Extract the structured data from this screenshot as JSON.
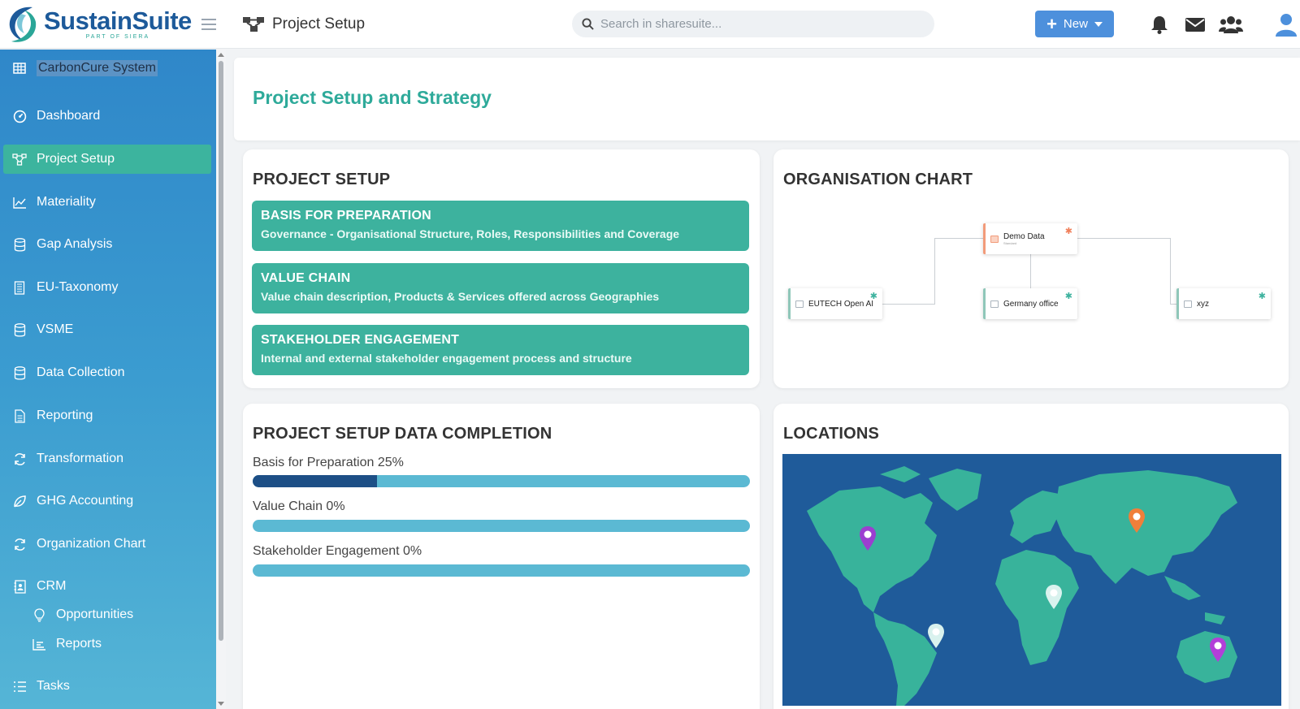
{
  "app": {
    "brand_name": "SustainSuite",
    "brand_sub": "PART OF SIERA"
  },
  "header": {
    "page_title": "Project Setup",
    "search_placeholder": "Search in sharesuite...",
    "new_button_label": "New"
  },
  "sidebar": {
    "company": "CarbonCure System",
    "items": [
      {
        "label": "Dashboard",
        "icon": "dashboard-icon"
      },
      {
        "label": "Project Setup",
        "icon": "project-setup-icon",
        "active": true
      },
      {
        "label": "Materiality",
        "icon": "line-chart-icon"
      },
      {
        "label": "Gap Analysis",
        "icon": "database-icon"
      },
      {
        "label": "EU-Taxonomy",
        "icon": "building-icon"
      },
      {
        "label": "VSME",
        "icon": "database-icon"
      },
      {
        "label": "Data Collection",
        "icon": "database-icon"
      },
      {
        "label": "Reporting",
        "icon": "document-icon"
      },
      {
        "label": "Transformation",
        "icon": "sync-icon"
      },
      {
        "label": "GHG Accounting",
        "icon": "leaf-icon"
      },
      {
        "label": "Organization Chart",
        "icon": "sync-icon"
      },
      {
        "label": "CRM",
        "icon": "contact-book-icon"
      }
    ],
    "crm_sub": [
      {
        "label": "Opportunities",
        "icon": "lightbulb-icon"
      },
      {
        "label": "Reports",
        "icon": "bar-chart-icon"
      }
    ],
    "tasks": {
      "label": "Tasks",
      "icon": "tasks-icon"
    }
  },
  "main": {
    "title": "Project Setup and Strategy",
    "project_setup": {
      "heading": "PROJECT SETUP",
      "tiles": [
        {
          "title": "BASIS FOR PREPARATION",
          "desc": "Governance - Organisational Structure, Roles, Responsibilities and Coverage"
        },
        {
          "title": "VALUE CHAIN",
          "desc": "Value chain description, Products & Services offered across Geographies"
        },
        {
          "title": "STAKEHOLDER ENGAGEMENT",
          "desc": "Internal and external stakeholder engagement process and structure"
        }
      ]
    },
    "org_chart": {
      "heading": "ORGANISATION CHART",
      "root": {
        "name": "Demo Data",
        "sub": "Standard"
      },
      "children": [
        {
          "name": "EUTECH Open AI"
        },
        {
          "name": "Germany office"
        },
        {
          "name": "xyz"
        }
      ]
    },
    "completion": {
      "heading": "PROJECT SETUP DATA COMPLETION",
      "items": [
        {
          "label": "Basis for Preparation 25%",
          "percent": 25
        },
        {
          "label": "Value Chain 0%",
          "percent": 0
        },
        {
          "label": "Stakeholder Engagement 0%",
          "percent": 0
        }
      ]
    },
    "locations": {
      "heading": "LOCATIONS",
      "pins": [
        {
          "color": "#9b3fd0"
        },
        {
          "color": "#f07f3a"
        },
        {
          "color": "#d9f2ee"
        },
        {
          "color": "#d9f2ee"
        },
        {
          "color": "#b23fd8"
        }
      ]
    }
  },
  "colors": {
    "accent": "#3db29e",
    "brand_blue": "#1d5a9a",
    "progress_fill": "#1d4f86",
    "progress_track": "#5bb9d3"
  }
}
